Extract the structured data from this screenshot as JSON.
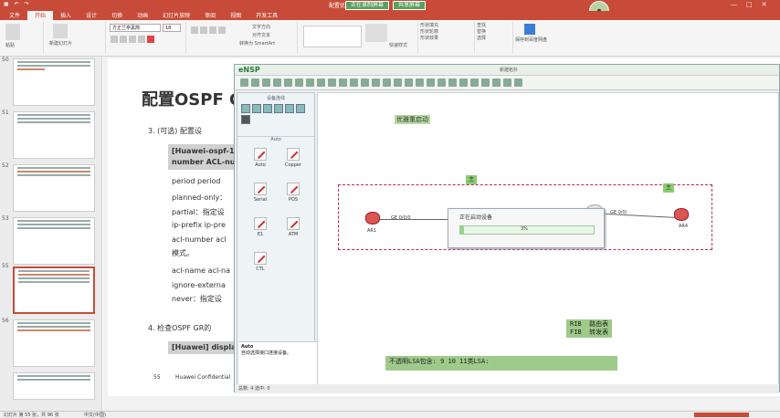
{
  "ppt": {
    "title": "配置优先...",
    "record_label": "正在录制屏幕",
    "share_label": "共享屏幕",
    "tabs": [
      "文件",
      "开始",
      "插入",
      "设计",
      "切换",
      "动画",
      "幻灯片放映",
      "审阅",
      "视图",
      "开发工具"
    ],
    "active_tab": 1,
    "font_name": "方正兰亭黑简",
    "font_size": "18",
    "ribbon_text": {
      "paste": "粘贴",
      "new_slide": "新建幻灯片",
      "text_dir": "文字方向",
      "align_text": "对齐文本",
      "smartart": "转换为 SmartArt",
      "quick_style": "快速样式",
      "find": "查找",
      "replace": "替换",
      "select": "选择",
      "save_share": "保存到百度网盘",
      "shape_fill": "形状填充",
      "shape_outline": "形状轮廓",
      "shape_effect": "形状效果"
    },
    "slide_numbers": [
      "50",
      "51",
      "52",
      "53",
      "54",
      "55",
      "56"
    ],
    "selected_slide": "55",
    "status_left": "幻灯片 第 55 张，共 96 张",
    "status_lang": "中文(中国)"
  },
  "slide": {
    "title": "配置OSPF G",
    "item3": "3.    (可选) 配置设",
    "box_line1": "[Huawei-ospf-1",
    "box_line2": "number ACL-nu",
    "period": "period period",
    "planned": "planned-only：",
    "partial": "partial：指定设",
    "ipprefix": "ip-prefix ip-pre",
    "aclnum": "acl-number acl",
    "mode": "模式。",
    "aclname": "acl-name acl-na",
    "ignore": "ignore-externa",
    "never": "never：指定设",
    "item4": "4.    检查OSPF GR的",
    "display": "[Huawei] displa",
    "page_num": "55",
    "footer": "Huawei Confidential"
  },
  "ensp": {
    "app_name": "eNSP",
    "window_title": "新建拓扑",
    "palette_title": "设备连线",
    "auto_section": "Auto",
    "cables": [
      "Auto",
      "Copper",
      "Serial",
      "POS",
      "E1",
      "ATM",
      "CTL"
    ],
    "auto_help_title": "Auto",
    "auto_help_text": "自动选择接口连接设备。",
    "status_text": "总数: 4  选中: 0",
    "note_top": "优雅重启动",
    "zone_left": "主",
    "zone_right": "主",
    "router_left": "AR1",
    "router_right": "AR4",
    "iface_left": "GE 0/0/0",
    "iface_right": "GE 0/0/",
    "progress_title": "正在启动设备",
    "progress_pct": "3%",
    "progress_value": 0.03,
    "rib_note": "RIB  路由表\nFIB  转发表",
    "lsa_note": "不透明LSA包含: 9 10 11类LSA:"
  },
  "colors": {
    "ppt_red": "#c74b38",
    "note_green": "#b6dba1"
  }
}
